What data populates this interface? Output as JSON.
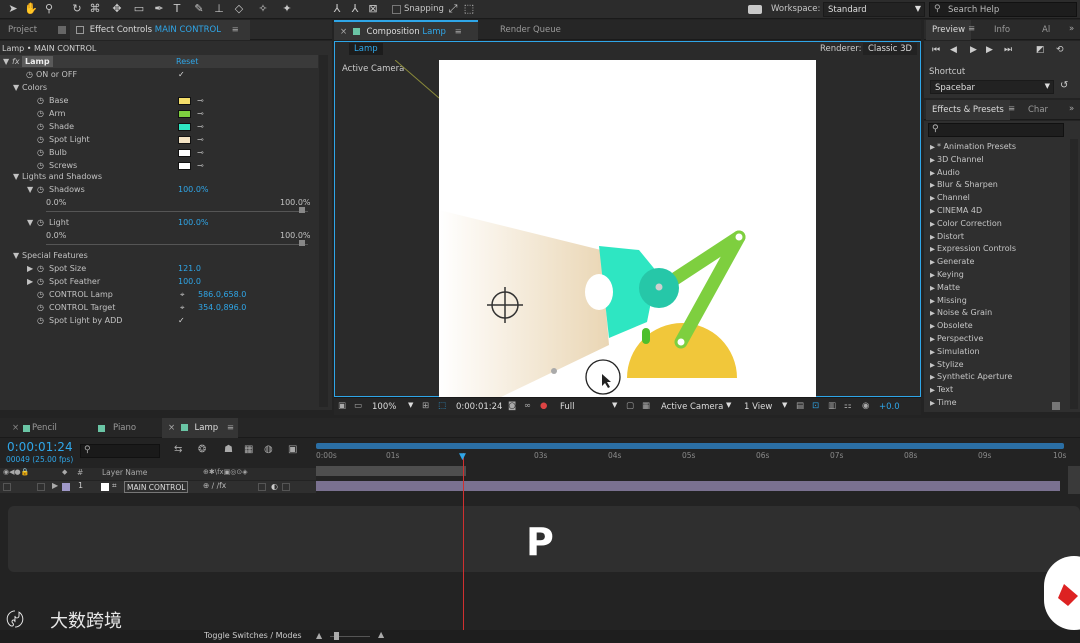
{
  "toolbar": {
    "snapping_label": "Snapping",
    "workspace_label": "Workspace:",
    "workspace_value": "Standard",
    "search_help_placeholder": "Search Help"
  },
  "left_tabs": {
    "project": "Project",
    "effect_controls_prefix": "Effect Controls",
    "effect_controls_layer": "MAIN CONTROL"
  },
  "effect_controls": {
    "breadcrumb": "Lamp • MAIN CONTROL",
    "effect_name": "Lamp",
    "reset_label": "Reset",
    "on_off_label": "ON or OFF",
    "colors_group": "Colors",
    "color_items": [
      {
        "label": "Base",
        "color": "#f5de6a"
      },
      {
        "label": "Arm",
        "color": "#7ecf3f"
      },
      {
        "label": "Shade",
        "color": "#2ee6c2"
      },
      {
        "label": "Spot Light",
        "color": "#f3e3c4"
      },
      {
        "label": "Bulb",
        "color": "#ffffff"
      },
      {
        "label": "Screws",
        "color": "#ffffff"
      }
    ],
    "lights_group": "Lights and Shadows",
    "shadows_label": "Shadows",
    "shadows_value": "100.0%",
    "light_label": "Light",
    "light_value": "100.0%",
    "slider_min": "0.0%",
    "slider_max": "100.0%",
    "special_group": "Special Features",
    "spot_size_label": "Spot Size",
    "spot_size_value": "121.0",
    "spot_feather_label": "Spot Feather",
    "spot_feather_value": "100.0",
    "control_lamp_label": "CONTROL Lamp",
    "control_lamp_value": "586.0,658.0",
    "control_target_label": "CONTROL Target",
    "control_target_value": "354.0,896.0",
    "spot_by_add_label": "Spot Light by ADD"
  },
  "composition": {
    "tab_prefix": "Composition",
    "tab_name": "Lamp",
    "render_queue": "Render Queue",
    "comp_tab": "Lamp",
    "renderer_label": "Renderer:",
    "renderer_value": "Classic 3D",
    "active_camera": "Active Camera",
    "zoom": "100%",
    "timecode": "0:00:01:24",
    "resolution": "Full",
    "view_camera": "Active Camera",
    "view_count": "1 View",
    "exposure": "+0.0"
  },
  "right_panel": {
    "preview_tab": "Preview",
    "info_tab": "Info",
    "ai_tab": "Al",
    "shortcut_label": "Shortcut",
    "shortcut_value": "Spacebar",
    "effects_tab": "Effects & Presets",
    "char_tab": "Char",
    "effects_list": [
      "* Animation Presets",
      "3D Channel",
      "Audio",
      "Blur & Sharpen",
      "Channel",
      "CINEMA 4D",
      "Color Correction",
      "Distort",
      "Expression Controls",
      "Generate",
      "Keying",
      "Matte",
      "Missing",
      "Noise & Grain",
      "Obsolete",
      "Perspective",
      "Simulation",
      "Stylize",
      "Synthetic Aperture",
      "Text",
      "Time"
    ]
  },
  "timeline": {
    "tabs": [
      "Pencil",
      "Piano",
      "Lamp"
    ],
    "timecode": "0:00:01:24",
    "frame_info": "00049 (25.00 fps)",
    "layer_name_header": "Layer Name",
    "hash_header": "#",
    "layer_number": "1",
    "layer_name": "MAIN CONTROL",
    "ruler": [
      "0:00s",
      "01s",
      "03s",
      "04s",
      "05s",
      "06s",
      "07s",
      "08s",
      "09s",
      "10s"
    ],
    "toggle_label": "Toggle Switches / Modes",
    "overlay_letter": "P",
    "watermark": "大数跨境"
  },
  "colors": {
    "accent": "#2fa6e8",
    "playhead": "#d03030"
  }
}
